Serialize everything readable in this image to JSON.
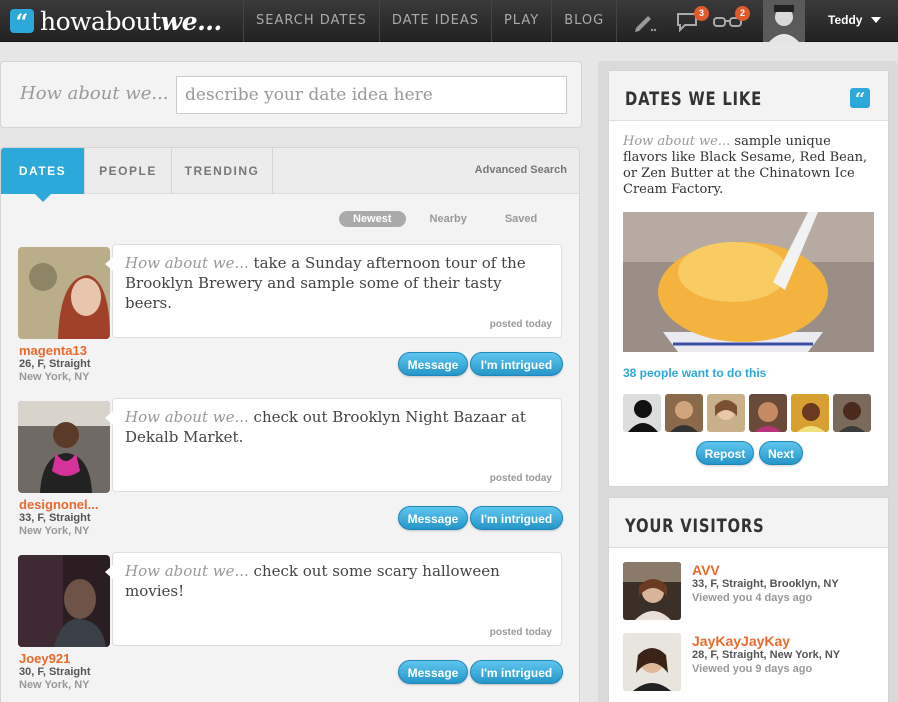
{
  "brand": {
    "badge": "“",
    "name_light": "howabout",
    "name_bold": "we..."
  },
  "nav": [
    "SEARCH DATES",
    "DATE IDEAS",
    "PLAY",
    "BLOG"
  ],
  "notifications": {
    "messages": "3",
    "views": "2"
  },
  "user": {
    "name": "Teddy"
  },
  "search": {
    "label": "How about we...",
    "placeholder": "describe your date idea here"
  },
  "tabs": [
    "DATES",
    "PEOPLE",
    "TRENDING"
  ],
  "advanced_search": "Advanced Search",
  "filters": [
    "Newest",
    "Nearby",
    "Saved"
  ],
  "posts": [
    {
      "prefix": "How about we...",
      "text": " take a Sunday afternoon tour of the Brooklyn Brewery and sample some of their tasty beers.",
      "posted": "posted today",
      "username": "magenta13",
      "details": "26, F, Straight",
      "location": "New York, NY"
    },
    {
      "prefix": "How about we...",
      "text": " check out Brooklyn Night Bazaar at Dekalb Market.",
      "posted": "posted today",
      "username": "designonel...",
      "details": "33, F, Straight",
      "location": "New York, NY"
    },
    {
      "prefix": "How about we...",
      "text": " check out some scary halloween movies!",
      "posted": "posted today",
      "username": "Joey921",
      "details": "30, F, Straight",
      "location": "New York, NY"
    }
  ],
  "buttons": {
    "message": "Message",
    "intrigued": "I'm intrigued"
  },
  "dates_we_like": {
    "title": "DATES WE LIKE",
    "badge": "“",
    "prefix": "How about we...",
    "text": " sample unique flavors like Black Sesame, Red Bean, or Zen Butter at the Chinatown Ice Cream Factory.",
    "want": "38 people want to do this",
    "repost": "Repost",
    "next": "Next"
  },
  "visitors": {
    "title": "YOUR VISITORS",
    "items": [
      {
        "name": "AVV",
        "details": "33, F, Straight, Brooklyn, NY",
        "viewed": "Viewed you 4 days ago"
      },
      {
        "name": "JayKayJayKay",
        "details": "28, F, Straight, New York, NY",
        "viewed": "Viewed you 9 days ago"
      }
    ]
  }
}
